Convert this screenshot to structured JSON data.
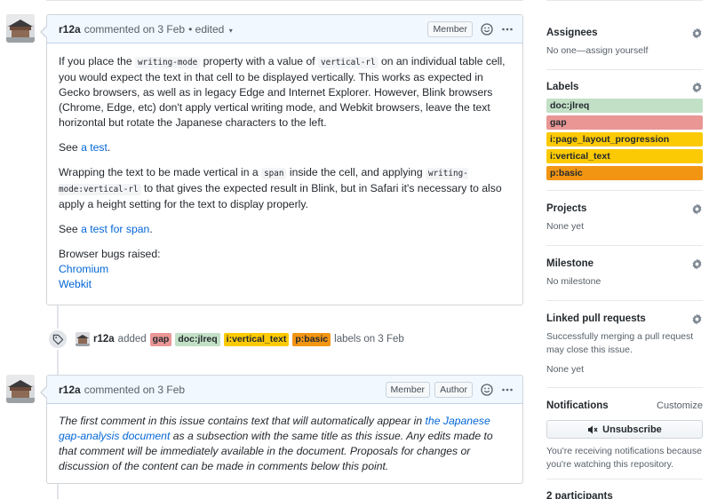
{
  "comment1": {
    "author": "r12a",
    "meta": "commented on 3 Feb",
    "edited": "• edited",
    "badge": "Member",
    "p1_a": "If you place the ",
    "p1_code1": "writing-mode",
    "p1_b": " property with a value of ",
    "p1_code2": "vertical-rl",
    "p1_c": " on an individual table cell, you would expect the text in that cell to be displayed vertically. This works as expected in Gecko browsers, as well as in legacy Edge and Internet Explorer. However, Blink browsers (Chrome, Edge, etc) don't apply vertical writing mode, and Webkit browsers, leave the text horizontal but rotate the Japanese characters to the left.",
    "p2_a": "See ",
    "p2_link": "a test",
    "p2_b": ".",
    "p3_a": "Wrapping the text to be made vertical in a ",
    "p3_code1": "span",
    "p3_b": " inside the cell, and applying ",
    "p3_code2": "writing-mode:vertical-rl",
    "p3_c": " to that gives the expected result in Blink, but in Safari it's necessary to also apply a height setting for the text to display properly.",
    "p4_a": "See ",
    "p4_link": "a test for span",
    "p4_b": ".",
    "p5": "Browser bugs raised:",
    "link_chromium": "Chromium",
    "link_webkit": "Webkit"
  },
  "event": {
    "author": "r12a",
    "action": "added",
    "labels": [
      "gap",
      "doc:jlreq",
      "i:vertical_text",
      "p:basic"
    ],
    "suffix": "labels on 3 Feb"
  },
  "comment2": {
    "author": "r12a",
    "meta": "commented on 3 Feb",
    "badge_member": "Member",
    "badge_author": "Author",
    "text_a": "The first comment in this issue contains text that will automatically appear in ",
    "link": "the Japanese gap-analysis document",
    "text_b": " as a subsection with the same title as this issue. Any edits made to that comment will be immediately available in the document. Proposals for changes or discussion of the content can be made in comments below this point."
  },
  "sidebar": {
    "assignees": {
      "title": "Assignees",
      "text": "No one—assign yourself"
    },
    "labels": {
      "title": "Labels",
      "items": [
        {
          "name": "doc:jlreq",
          "color": "#c2e0c6"
        },
        {
          "name": "gap",
          "color": "#e99695"
        },
        {
          "name": "i:page_layout_progression",
          "color": "#fbca04"
        },
        {
          "name": "i:vertical_text",
          "color": "#fbca04"
        },
        {
          "name": "p:basic",
          "color": "#f29513"
        }
      ]
    },
    "projects": {
      "title": "Projects",
      "text": "None yet"
    },
    "milestone": {
      "title": "Milestone",
      "text": "No milestone"
    },
    "linked": {
      "title": "Linked pull requests",
      "text": "Successfully merging a pull request may close this issue.",
      "text2": "None yet"
    },
    "notifications": {
      "title": "Notifications",
      "customize": "Customize",
      "button": "Unsubscribe",
      "text": "You're receiving notifications because you're watching this repository."
    },
    "participants": {
      "title": "2 participants"
    }
  },
  "colors": {
    "gap": "#e99695",
    "doc_jlreq": "#c2e0c6",
    "vertical_text": "#fbca04",
    "basic": "#f29513"
  }
}
